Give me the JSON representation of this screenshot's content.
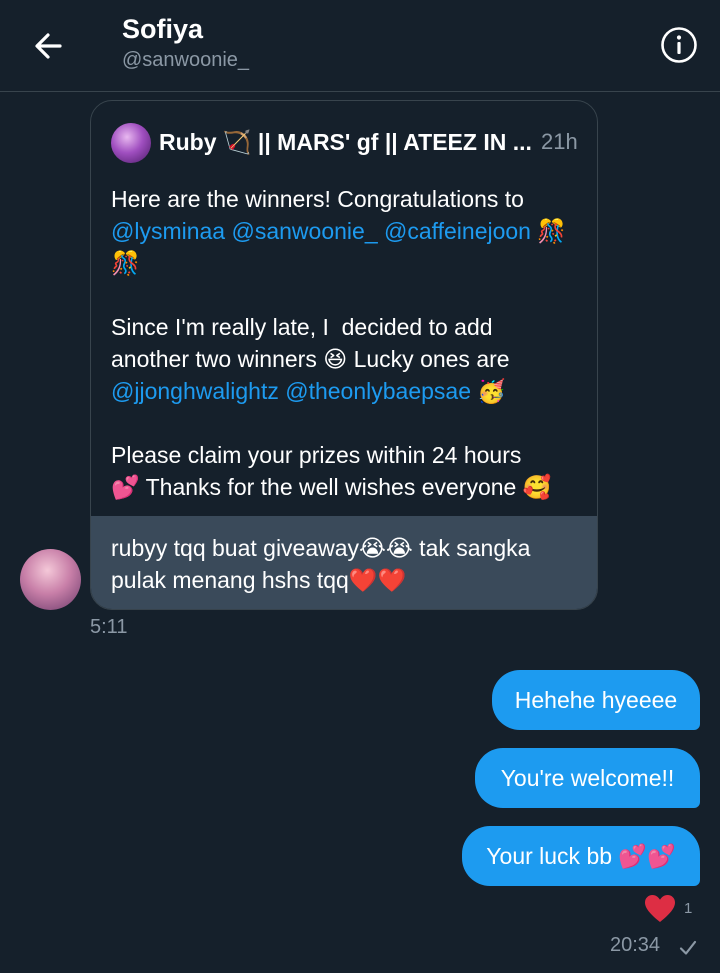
{
  "header": {
    "title": "Sofiya",
    "handle": "@sanwoonie_",
    "back_icon": "arrow-left-icon",
    "info_icon": "info-icon"
  },
  "quoted_tweet": {
    "author": "Ruby 🏹 || MARS' gf || ATEEZ IN ...",
    "time": "21h",
    "line1": "Here are the winners! Congratulations to",
    "mention1": "@lysminaa",
    "mention2": "@sanwoonie_",
    "mention3": "@caffeinejoon",
    "emoji1": " 🎊",
    "emoji2": "🎊",
    "line3": "Since I'm really late, I  decided to add",
    "line4": "another two winners 😆 Lucky ones are",
    "mention4": "@jjonghwalightz",
    "mention5": "@theonlybaepsae",
    "emoji3": " 🥳",
    "line6": "Please claim your prizes within 24 hours",
    "line7": "💕 Thanks for the well wishes everyone 🥰"
  },
  "received": {
    "text": "rubyy tqq buat giveaway😭😭 tak sangka pulak menang hshs tqq❤️❤️",
    "time": "5:11"
  },
  "sent": [
    {
      "text": "Hehehe hyeeee"
    },
    {
      "text": "You're welcome!!"
    },
    {
      "text": "Your luck bb 💕💕"
    }
  ],
  "reaction": {
    "emoji": "heart",
    "count": "1"
  },
  "sent_time": "20:34",
  "colors": {
    "background": "#15202b",
    "accent": "#1d9bf0",
    "muted": "#8b98a5",
    "border": "#38444d"
  }
}
